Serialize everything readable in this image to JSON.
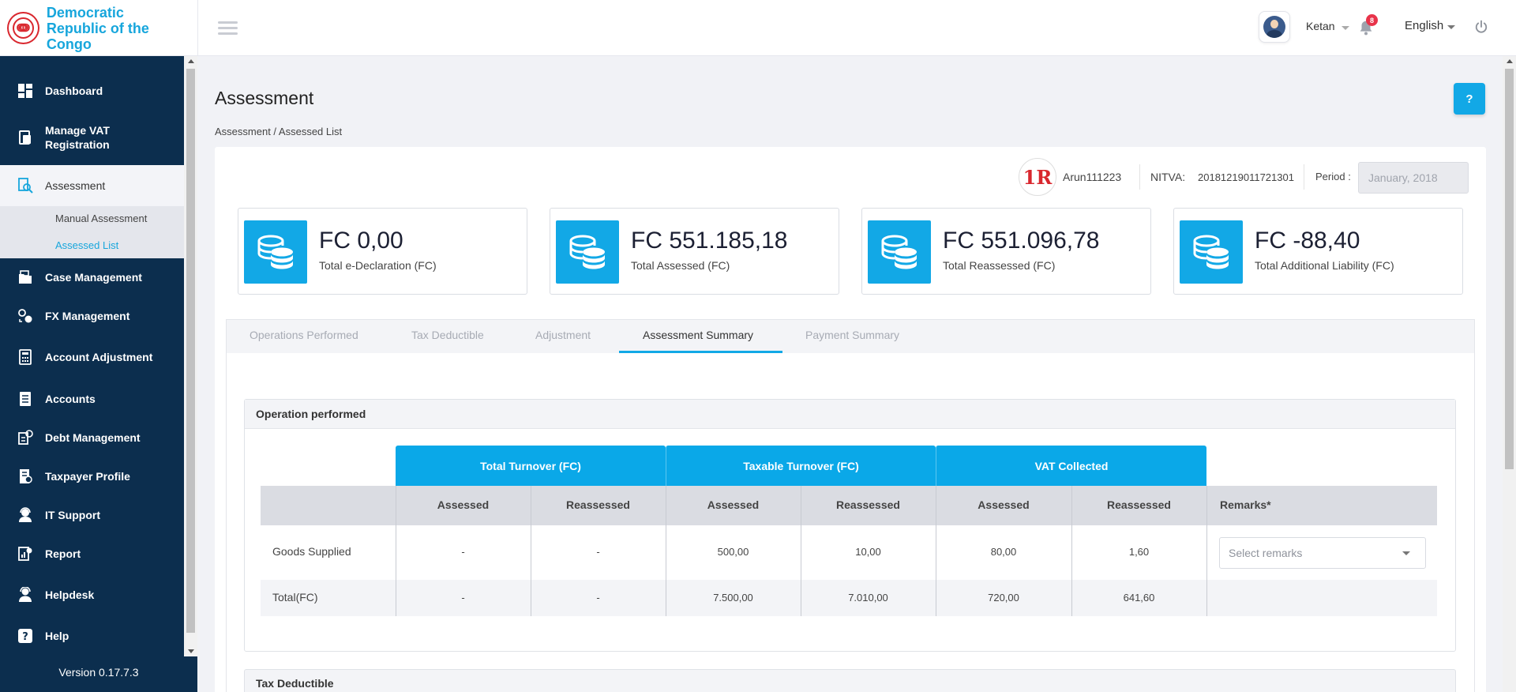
{
  "brand": {
    "name_line1": "Democratic",
    "name_line2": "Republic of the Congo",
    "logo_glyph": "ↈ"
  },
  "header": {
    "user_name": "Ketan",
    "notification_count": "8",
    "language": "English",
    "icons": [
      "menu-icon",
      "user-avatar",
      "bell-icon",
      "power-icon"
    ]
  },
  "sidebar": {
    "items": [
      {
        "label": "Dashboard",
        "icon": "dashboard-icon"
      },
      {
        "label": "Manage VAT Registration",
        "icon": "vat-registration-icon"
      },
      {
        "label": "Assessment",
        "icon": "assessment-icon"
      },
      {
        "label": "Case Management",
        "icon": "case-icon"
      },
      {
        "label": "FX Management",
        "icon": "fx-icon"
      },
      {
        "label": "Account Adjustment",
        "icon": "account-adjustment-icon"
      },
      {
        "label": "Accounts",
        "icon": "accounts-icon"
      },
      {
        "label": "Debt Management",
        "icon": "debt-icon"
      },
      {
        "label": "Taxpayer Profile",
        "icon": "taxpayer-icon"
      },
      {
        "label": "IT Support",
        "icon": "it-support-icon"
      },
      {
        "label": "Report",
        "icon": "report-icon"
      },
      {
        "label": "Helpdesk",
        "icon": "helpdesk-icon"
      },
      {
        "label": "Help",
        "icon": "help-icon"
      }
    ],
    "sub_items": [
      "Manual Assessment",
      "Assessed List"
    ],
    "version": "Version 0.17.7.3"
  },
  "page": {
    "title": "Assessment",
    "breadcrumb": "Assessment / Assessed List",
    "help_label": "?"
  },
  "taxpayer": {
    "logo_text": "1R",
    "name": "Arun111223",
    "nitva_label": "NITVA:",
    "nitva_value": "20181219011721301",
    "period_label": "Period :",
    "period_value": "January, 2018"
  },
  "stats": [
    {
      "value": "FC 0,00",
      "caption": "Total e-Declaration (FC)"
    },
    {
      "value": "FC 551.185,18",
      "caption": "Total Assessed (FC)"
    },
    {
      "value": "FC 551.096,78",
      "caption": "Total Reassessed (FC)"
    },
    {
      "value": "FC -88,40",
      "caption": "Total Additional Liability (FC)"
    }
  ],
  "tabs": [
    "Operations Performed",
    "Tax Deductible",
    "Adjustment",
    "Assessment Summary",
    "Payment Summary"
  ],
  "active_tab": "Assessment Summary",
  "operation_panel": {
    "title": "Operation performed",
    "groups": [
      "Total Turnover (FC)",
      "Taxable Turnover (FC)",
      "VAT Collected"
    ],
    "subheaders": [
      "Assessed",
      "Reassessed",
      "Assessed",
      "Reassessed",
      "Assessed",
      "Reassessed",
      "Remarks*"
    ],
    "rows": [
      {
        "label": "Goods Supplied",
        "cells": [
          "-",
          "-",
          "500,00",
          "10,00",
          "80,00",
          "1,60"
        ],
        "remarks_placeholder": "Select remarks"
      },
      {
        "label": "Total(FC)",
        "cells": [
          "-",
          "-",
          "7.500,00",
          "7.010,00",
          "720,00",
          "641,60"
        ]
      }
    ]
  },
  "next_panel": {
    "title": "Tax Deductible"
  },
  "colors": {
    "primary": "#12a8e6",
    "sidebar": "#0c2e4e",
    "brand": "#17a6dc",
    "badge": "#e8334a"
  }
}
